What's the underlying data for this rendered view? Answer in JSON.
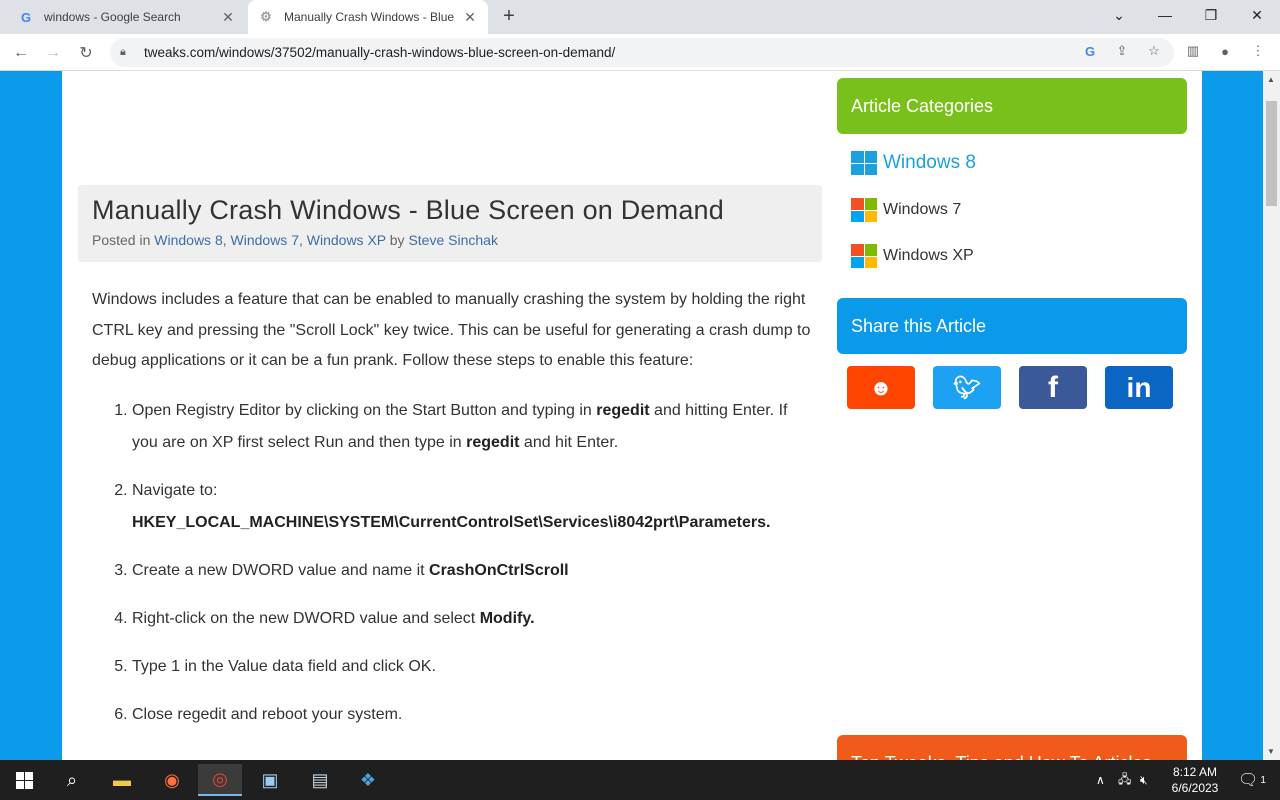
{
  "browser": {
    "tabs": [
      {
        "title": "windows - Google Search",
        "favicon": "google-g-icon"
      },
      {
        "title": "Manually Crash Windows - Blue",
        "favicon": "tweaks-icon"
      }
    ],
    "new_tab": "+",
    "url": "tweaks.com/windows/37502/manually-crash-windows-blue-screen-on-demand/"
  },
  "article": {
    "title": "Manually Crash Windows - Blue Screen on Demand",
    "posted_in": "Posted in",
    "categories": [
      "Windows 8",
      "Windows 7",
      "Windows XP"
    ],
    "by": "by",
    "author": "Steve Sinchak",
    "intro": "Windows includes a feature that can be enabled to manually crashing the system by holding the right CTRL key and pressing the \"Scroll Lock\" key twice. This can be useful for generating a crash dump to debug applications or it can be a fun prank. Follow these steps to enable this feature:",
    "steps": [
      {
        "a": "Open Registry Editor by clicking on the Start Button and typing in ",
        "b": "regedit",
        "c": " and hitting Enter.  If you are on XP first select Run and then type in ",
        "d": "regedit",
        "e": " and hit Enter."
      },
      {
        "a": "Navigate to: ",
        "b": "HKEY_LOCAL_MACHINE\\SYSTEM\\CurrentControlSet\\Services\\i8042prt\\Parameters."
      },
      {
        "a": "Create a new DWORD value and name it ",
        "b": "CrashOnCtrlScroll"
      },
      {
        "a": "Right-click on the new DWORD value and select ",
        "b": "Modify."
      },
      {
        "a": "Type 1 in the Value data field and click OK."
      },
      {
        "a": "Close regedit and reboot your system."
      }
    ]
  },
  "sidebar": {
    "categories_title": "Article Categories",
    "categories": [
      "Windows 8",
      "Windows 7",
      "Windows XP"
    ],
    "share_title": "Share this Article",
    "share_buttons": [
      {
        "name": "reddit",
        "color": "#ff4500"
      },
      {
        "name": "twitter",
        "color": "#1da1f2"
      },
      {
        "name": "facebook",
        "color": "#3b5998"
      },
      {
        "name": "linkedin",
        "color": "#0a66c2"
      }
    ],
    "bottom_heading": "Top Tweaks, Tips and How To Articles"
  },
  "taskbar": {
    "time": "8:12 AM",
    "date": "6/6/2023",
    "notification_count": "1"
  },
  "colors": {
    "page_bg": "#0b9aea",
    "green": "#7ac01c",
    "orange": "#f05a1a",
    "link": "#3a6ea8"
  }
}
